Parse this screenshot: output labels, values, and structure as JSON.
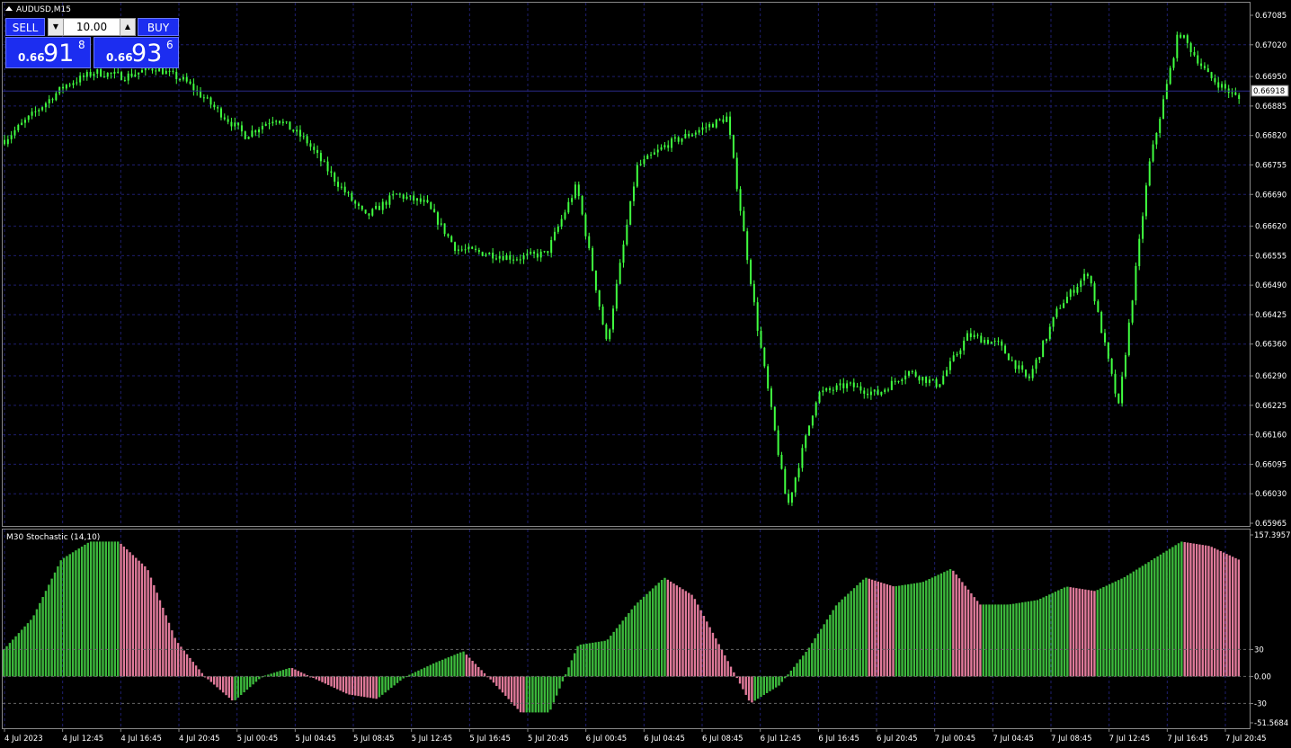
{
  "chart": {
    "symbol_label": "AUDUSD,M15",
    "current_price_label": "0.66918",
    "price_axis": [
      "0.67085",
      "0.67020",
      "0.66950",
      "0.66885",
      "0.66820",
      "0.66755",
      "0.66690",
      "0.66620",
      "0.66555",
      "0.66490",
      "0.66425",
      "0.66360",
      "0.66290",
      "0.66225",
      "0.66160",
      "0.66095",
      "0.66030",
      "0.65965"
    ],
    "time_axis": [
      "4 Jul 2023",
      "4 Jul 12:45",
      "4 Jul 16:45",
      "4 Jul 20:45",
      "5 Jul 00:45",
      "5 Jul 04:45",
      "5 Jul 08:45",
      "5 Jul 12:45",
      "5 Jul 16:45",
      "5 Jul 20:45",
      "6 Jul 00:45",
      "6 Jul 04:45",
      "6 Jul 08:45",
      "6 Jul 12:45",
      "6 Jul 16:45",
      "6 Jul 20:45",
      "7 Jul 00:45",
      "7 Jul 04:45",
      "7 Jul 08:45",
      "7 Jul 12:45",
      "7 Jul 16:45",
      "7 Jul 20:45"
    ],
    "colors": {
      "background": "#000000",
      "grid": "#1e1e6e",
      "candle": "#40ff40",
      "bid_line": "#2a2a8a",
      "hist_up": "#3cb83c",
      "hist_down": "#e07a9a"
    }
  },
  "trade_panel": {
    "sell_label": "SELL",
    "buy_label": "BUY",
    "lot_value": "10.00",
    "bid": {
      "prefix": "0.66",
      "big": "91",
      "sup": "8"
    },
    "ask": {
      "prefix": "0.66",
      "big": "93",
      "sup": "6"
    }
  },
  "indicator": {
    "label": "M30 Stochastic (14,10)",
    "axis": [
      "157.3957",
      "30",
      "0.00",
      "-30",
      "-51.5684"
    ]
  },
  "chart_data": [
    {
      "type": "candlestick",
      "title": "AUDUSD,M15",
      "ylim": [
        0.65965,
        0.67085
      ],
      "x_ticks": [
        "4 Jul 2023",
        "4 Jul 12:45",
        "4 Jul 16:45",
        "4 Jul 20:45",
        "5 Jul 00:45",
        "5 Jul 04:45",
        "5 Jul 08:45",
        "5 Jul 12:45",
        "5 Jul 16:45",
        "5 Jul 20:45",
        "6 Jul 00:45",
        "6 Jul 04:45",
        "6 Jul 08:45",
        "6 Jul 12:45",
        "6 Jul 16:45",
        "6 Jul 20:45",
        "7 Jul 00:45",
        "7 Jul 04:45",
        "7 Jul 08:45",
        "7 Jul 12:45",
        "7 Jul 16:45",
        "7 Jul 20:45"
      ],
      "close_path": [
        0.6681,
        0.6687,
        0.6693,
        0.6696,
        0.6695,
        0.6697,
        0.6694,
        0.6688,
        0.6682,
        0.6686,
        0.6681,
        0.6672,
        0.6664,
        0.6669,
        0.6667,
        0.6657,
        0.6656,
        0.6655,
        0.6656,
        0.6671,
        0.6636,
        0.6675,
        0.668,
        0.6683,
        0.6686,
        0.664,
        0.66,
        0.6625,
        0.6627,
        0.6625,
        0.663,
        0.6627,
        0.6638,
        0.6636,
        0.6628,
        0.6644,
        0.6652,
        0.6622,
        0.6675,
        0.6705,
        0.6695,
        0.669
      ],
      "last_price": 0.66918
    },
    {
      "type": "histogram",
      "title": "M30 Stochastic (14,10)",
      "ylim": [
        -51.5684,
        157.3957
      ],
      "levels": [
        30,
        0,
        -30
      ],
      "values": [
        30,
        65,
        130,
        150,
        150,
        120,
        40,
        0,
        -28,
        0,
        10,
        -5,
        -20,
        -25,
        0,
        15,
        28,
        -5,
        -40,
        -40,
        35,
        40,
        80,
        110,
        90,
        30,
        -30,
        -10,
        30,
        80,
        110,
        100,
        105,
        120,
        80,
        80,
        85,
        100,
        95,
        110,
        130,
        150,
        145,
        130
      ]
    }
  ]
}
